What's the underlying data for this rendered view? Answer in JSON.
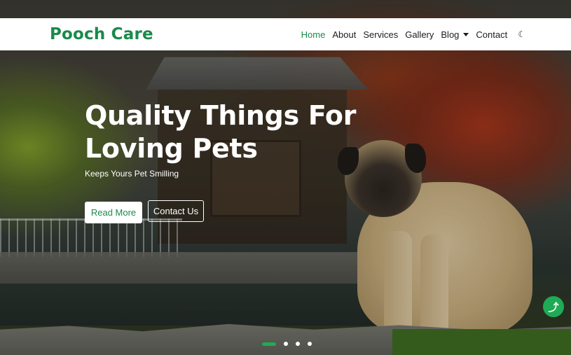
{
  "brand": {
    "name": "Pooch Care",
    "color": "#1a8a4a"
  },
  "nav": {
    "items": [
      {
        "label": "Home",
        "active": true
      },
      {
        "label": "About"
      },
      {
        "label": "Services"
      },
      {
        "label": "Gallery"
      },
      {
        "label": "Blog",
        "dropdown": true
      },
      {
        "label": "Contact"
      }
    ],
    "theme_toggle_icon": "moon-icon"
  },
  "hero": {
    "title": "Quality Things For Loving Pets",
    "subtitle": "Keeps Yours Pet Smilling",
    "buttons": {
      "read_more": "Read More",
      "contact_us": "Contact Us"
    }
  },
  "carousel": {
    "slides": 4,
    "active_index": 0
  },
  "scroll_top": {
    "icon": "arrow-up-icon",
    "glyph": "⤴"
  },
  "colors": {
    "accent": "#1faa55",
    "text_dark": "#1d1d1d"
  }
}
